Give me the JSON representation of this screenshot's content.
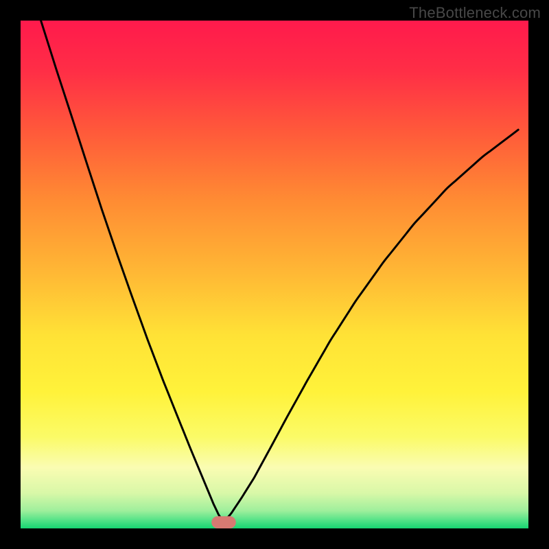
{
  "watermark": "TheBottleneck.com",
  "chart_data": {
    "type": "line",
    "title": "",
    "xlabel": "",
    "ylabel": "",
    "xlim": [
      0,
      1
    ],
    "ylim": [
      0,
      1
    ],
    "gradient_stops": [
      {
        "offset": 0.0,
        "color": "#ff1a4c"
      },
      {
        "offset": 0.1,
        "color": "#ff2e46"
      },
      {
        "offset": 0.22,
        "color": "#ff5a3a"
      },
      {
        "offset": 0.35,
        "color": "#ff8a33"
      },
      {
        "offset": 0.5,
        "color": "#ffb935"
      },
      {
        "offset": 0.62,
        "color": "#ffe236"
      },
      {
        "offset": 0.73,
        "color": "#fff23a"
      },
      {
        "offset": 0.82,
        "color": "#fbfb67"
      },
      {
        "offset": 0.88,
        "color": "#fafcb2"
      },
      {
        "offset": 0.93,
        "color": "#d9f8a8"
      },
      {
        "offset": 0.965,
        "color": "#9fef9c"
      },
      {
        "offset": 0.985,
        "color": "#4fe286"
      },
      {
        "offset": 1.0,
        "color": "#16d572"
      }
    ],
    "minimum": {
      "x": 0.4,
      "y": 0.012
    },
    "marker": {
      "x": 0.4,
      "y": 0.012,
      "color": "#d77a72",
      "rx": 0.024,
      "ry": 0.012
    },
    "left_branch": {
      "x": [
        0.04,
        0.07,
        0.1,
        0.13,
        0.16,
        0.19,
        0.22,
        0.25,
        0.28,
        0.31,
        0.335,
        0.355,
        0.37,
        0.38,
        0.39,
        0.4
      ],
      "y": [
        1.0,
        0.905,
        0.813,
        0.72,
        0.628,
        0.54,
        0.455,
        0.372,
        0.293,
        0.218,
        0.156,
        0.108,
        0.072,
        0.048,
        0.027,
        0.012
      ]
    },
    "right_branch": {
      "x": [
        0.4,
        0.415,
        0.435,
        0.46,
        0.49,
        0.525,
        0.565,
        0.61,
        0.66,
        0.715,
        0.775,
        0.84,
        0.91,
        0.98
      ],
      "y": [
        0.012,
        0.03,
        0.06,
        0.1,
        0.155,
        0.22,
        0.292,
        0.37,
        0.448,
        0.525,
        0.6,
        0.67,
        0.732,
        0.785
      ]
    }
  }
}
